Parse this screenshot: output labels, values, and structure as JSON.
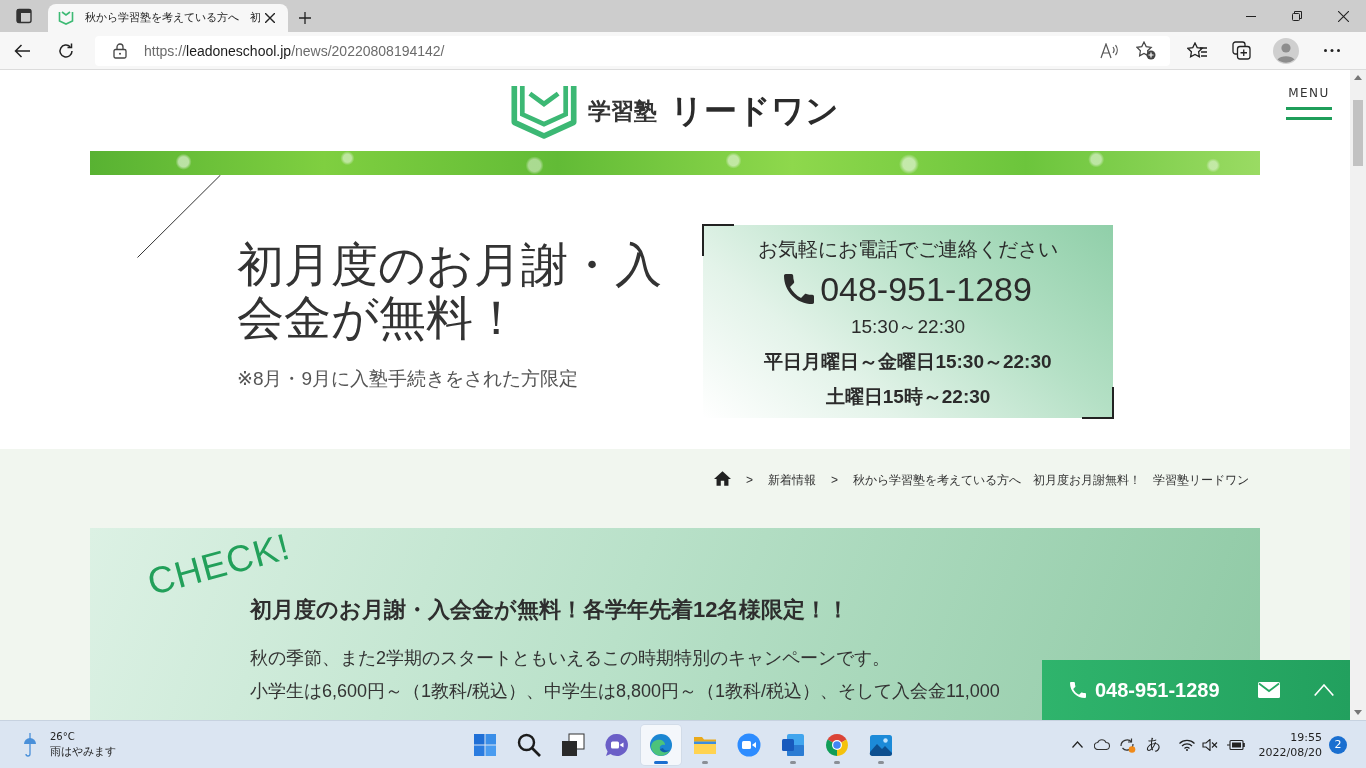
{
  "browser": {
    "tab_title": "秋から学習塾を考えている方へ　初",
    "url": {
      "scheme": "https://",
      "host": "leadoneschool.jp",
      "path": "/news/20220808194142/"
    }
  },
  "header": {
    "logo_prefix": "学習塾",
    "logo_name": "リードワン",
    "menu_label": "MENU"
  },
  "hero": {
    "title": "初月度のお月謝・入会金が無料！",
    "note": "※8月・9月に入塾手続きをされた方限定",
    "contact": {
      "lead": "お気軽にお電話でご連絡ください",
      "phone": "048-951-1289",
      "hours": [
        {
          "text": "15:30～22:30",
          "bold": false
        },
        {
          "text": "平日月曜日～金曜日15:30～22:30",
          "bold": true
        },
        {
          "text": "土曜日15時～22:30",
          "bold": true
        }
      ]
    }
  },
  "breadcrumb": {
    "items": [
      {
        "kind": "home"
      },
      {
        "kind": "link",
        "separator": ">",
        "label": "新着情報"
      },
      {
        "kind": "current",
        "separator": ">",
        "label": "秋から学習塾を考えている方へ　初月度お月謝無料！　学習塾リードワン"
      }
    ]
  },
  "check_card": {
    "badge": "CHECK!",
    "heading": "初月度のお月謝・入会金が無料！各学年先着12名様限定！！",
    "lines": [
      "秋の季節、また2学期のスタートともいえるこの時期特別のキャンペーンです。",
      "小学生は6,600円～（1教科/税込）、中学生は8,800円～（1教科/税込）、そして入会金11,000"
    ]
  },
  "floating_bar": {
    "phone": "048-951-1289"
  },
  "taskbar": {
    "weather": {
      "temperature": "26°C",
      "forecast": "雨はやみます"
    },
    "apps": [
      {
        "kind": "start",
        "running": false,
        "selected": false
      },
      {
        "kind": "search",
        "running": false,
        "selected": false
      },
      {
        "kind": "task_view",
        "running": false,
        "selected": false
      },
      {
        "kind": "chat",
        "running": false,
        "selected": false
      },
      {
        "kind": "edge",
        "running": true,
        "selected": true
      },
      {
        "kind": "explorer",
        "running": true,
        "selected": false
      },
      {
        "kind": "zoom",
        "running": false,
        "selected": false
      },
      {
        "kind": "word",
        "running": true,
        "selected": false
      },
      {
        "kind": "chrome",
        "running": true,
        "selected": false
      },
      {
        "kind": "photos",
        "running": true,
        "selected": false
      }
    ],
    "ime": "あ",
    "clock": {
      "time": "19:55",
      "date": "2022/08/20"
    },
    "notifications": "2"
  }
}
